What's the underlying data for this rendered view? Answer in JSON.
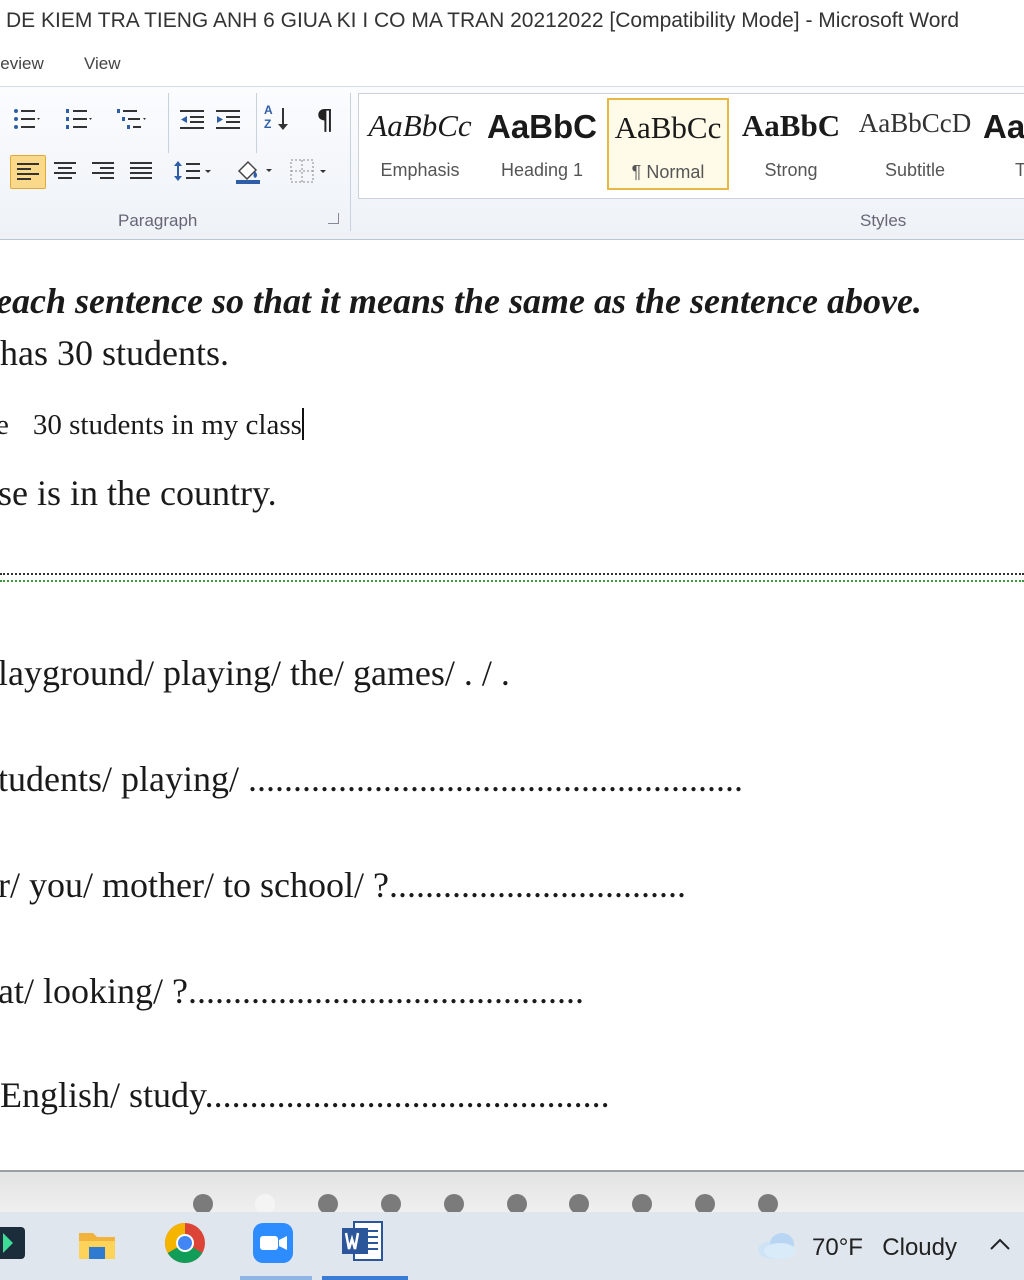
{
  "window": {
    "title": "DE KIEM TRA TIENG ANH 6 GIUA KI I CO MA TRAN 20212022 [Compatibility Mode]  -  Microsoft Word"
  },
  "menu": {
    "tabs": [
      {
        "label": "Review"
      },
      {
        "label": "View"
      }
    ]
  },
  "ribbon": {
    "paragraph_group_label": "Paragraph",
    "styles_group_label": "Styles",
    "pilcrow_symbol": "¶",
    "sort_label": "A Z",
    "styles": [
      {
        "preview": "AaBbCc",
        "name": "Emphasis"
      },
      {
        "preview": "AaBbC",
        "name": "Heading 1"
      },
      {
        "preview": "AaBbCc",
        "name": "¶ Normal",
        "selected": true
      },
      {
        "preview": "AaBbC",
        "name": "Strong"
      },
      {
        "preview": "AaBbCcD",
        "name": "Subtitle"
      },
      {
        "preview": "Aa",
        "name": "T"
      }
    ],
    "accent_color": "#e6b945"
  },
  "document": {
    "instruction": "each sentence so that it means the same as the sentence above.",
    "lines": [
      {
        "text": " has 30 students."
      },
      {
        "prefix": "e",
        "text": "30 students in my class"
      },
      {
        "text": "se is in the country."
      },
      {
        "text": "layground/ playing/ the/ games/ . / ."
      },
      {
        "text": "tudents/ playing/ ......................................................."
      },
      {
        "text": "r/ you/ mother/ to school/ ?................................."
      },
      {
        "text": "at/ looking/ ?............................................"
      },
      {
        "text": " English/ study............................................."
      }
    ]
  },
  "taskbar": {
    "icons": [
      "app-launcher-icon",
      "file-explorer-icon",
      "chrome-icon",
      "zoom-icon",
      "word-icon"
    ],
    "weather": {
      "temperature": "70°F",
      "condition": "Cloudy"
    },
    "active_color": "#3a7bd5"
  }
}
